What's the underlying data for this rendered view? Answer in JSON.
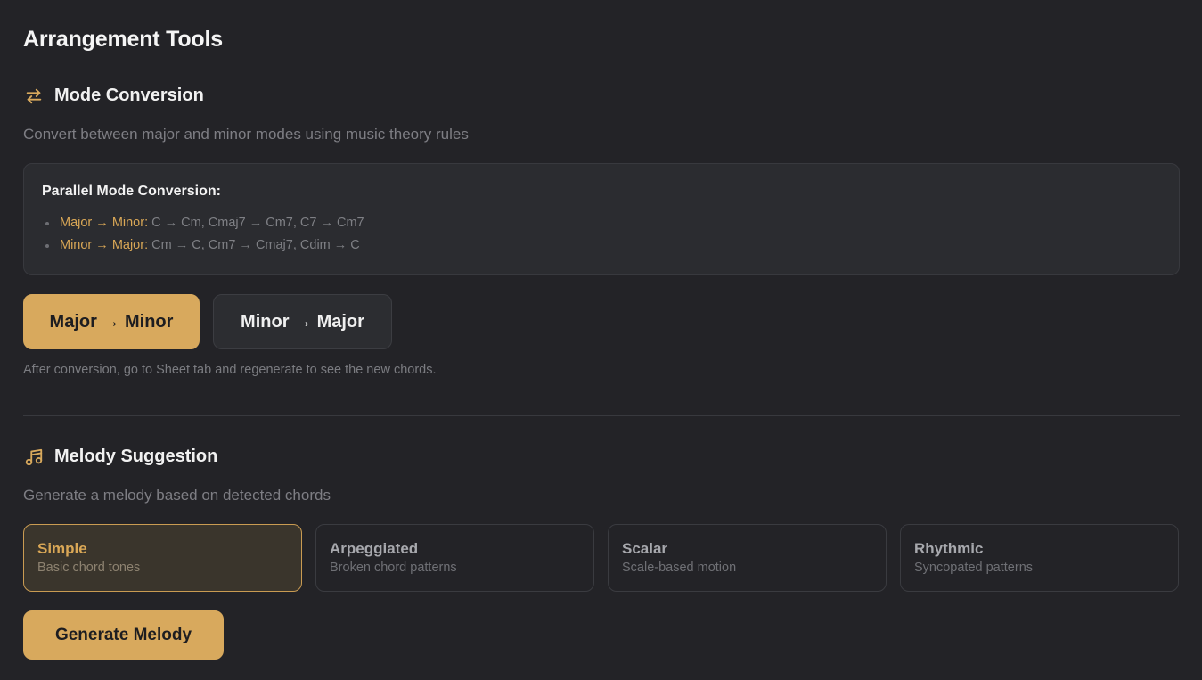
{
  "page": {
    "title": "Arrangement Tools"
  },
  "mode_conversion": {
    "icon": "arrows-swap-icon",
    "title": "Mode Conversion",
    "description": "Convert between major and minor modes using music theory rules",
    "info_box": {
      "title": "Parallel Mode Conversion:",
      "rules": [
        {
          "label": "Major → Minor:",
          "text": "C → Cm, Cmaj7 → Cm7, C7 → Cm7"
        },
        {
          "label": "Minor → Major:",
          "text": "Cm → C, Cm7 → Cmaj7, Cdim → C"
        }
      ]
    },
    "buttons": {
      "major_to_minor": "Major → Minor",
      "minor_to_major": "Minor → Major"
    },
    "hint": "After conversion, go to Sheet tab and regenerate to see the new chords."
  },
  "melody_suggestion": {
    "icon": "music-notes-icon",
    "title": "Melody Suggestion",
    "description": "Generate a melody based on detected chords",
    "styles": [
      {
        "title": "Simple",
        "subtitle": "Basic chord tones",
        "selected": true
      },
      {
        "title": "Arpeggiated",
        "subtitle": "Broken chord patterns",
        "selected": false
      },
      {
        "title": "Scalar",
        "subtitle": "Scale-based motion",
        "selected": false
      },
      {
        "title": "Rhythmic",
        "subtitle": "Syncopated patterns",
        "selected": false
      }
    ],
    "generate_button": "Generate Melody"
  },
  "colors": {
    "background": "#232327",
    "accent": "#d8a95d",
    "panel": "#2b2c30",
    "muted_text": "#7e7e84"
  }
}
